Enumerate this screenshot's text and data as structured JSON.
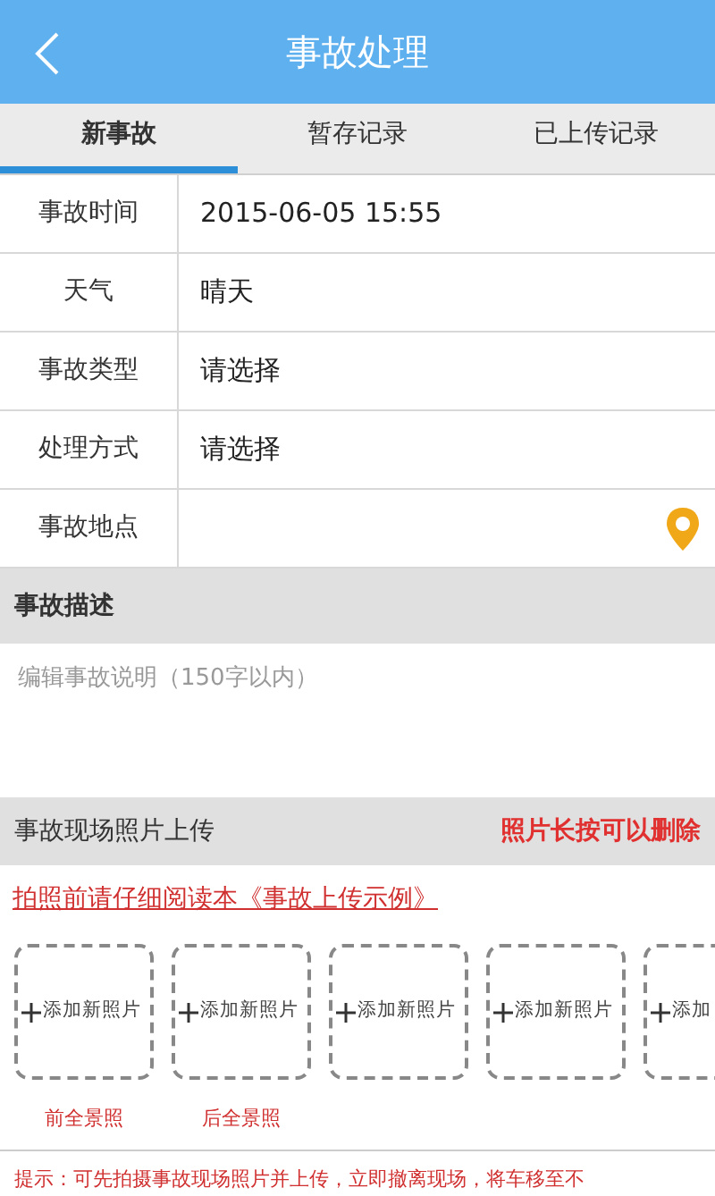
{
  "header": {
    "title": "事故处理"
  },
  "tabs": [
    {
      "label": "新事故",
      "selected": true
    },
    {
      "label": "暂存记录",
      "selected": false
    },
    {
      "label": "已上传记录",
      "selected": false
    }
  ],
  "form": [
    {
      "label": "事故时间",
      "value": "2015-06-05 15:55",
      "kind": "text"
    },
    {
      "label": "天气",
      "value": "晴天",
      "kind": "text"
    },
    {
      "label": "事故类型",
      "value": "请选择",
      "kind": "text"
    },
    {
      "label": "处理方式",
      "value": "请选择",
      "kind": "text"
    },
    {
      "label": "事故地点",
      "kind": "location"
    }
  ],
  "description": {
    "title": "事故描述",
    "placeholder": "编辑事故说明（150字以内）"
  },
  "photos": {
    "title": "事故现场照片上传",
    "note": "照片长按可以删除",
    "link": "拍照前请仔细阅读本《事故上传示例》",
    "tiles": [
      {
        "label": "添加新照片",
        "caption": "前全景照"
      },
      {
        "label": "添加新照片",
        "caption": "后全景照"
      },
      {
        "label": "添加新照片"
      },
      {
        "label": "添加新照片"
      },
      {
        "label": "添加"
      }
    ]
  },
  "hint": "提示：可先拍摄事故现场照片并上传，立即撤离现场，将车移至不"
}
